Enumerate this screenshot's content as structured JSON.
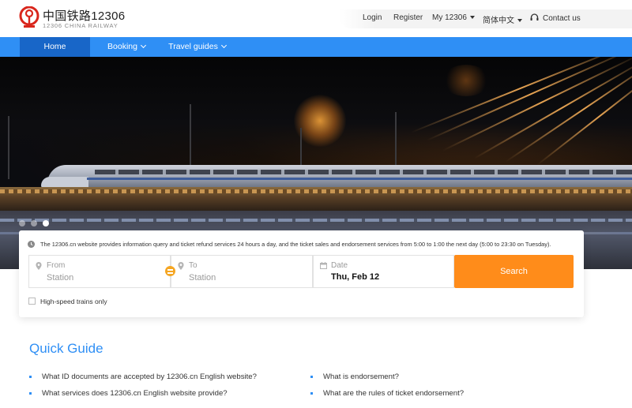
{
  "header": {
    "logo_cn": "中国铁路12306",
    "logo_en": "12306 CHINA RAILWAY",
    "links": {
      "login": "Login",
      "register": "Register",
      "my12306": "My 12306",
      "language": "简体中文",
      "contact": "Contact us"
    }
  },
  "nav": {
    "home": "Home",
    "booking": "Booking",
    "travel_guides": "Travel guides"
  },
  "hero": {
    "slides_count": 3,
    "active_slide": 3
  },
  "search": {
    "notice": "The 12306.cn website provides information query and ticket refund services 24 hours a day, and the ticket sales and endorsement services from 5:00 to 1:00 the next day (5:00 to 23:30 on Tuesday).",
    "from_label": "From",
    "from_placeholder": "Station",
    "to_label": "To",
    "to_placeholder": "Station",
    "date_label": "Date",
    "date_value": "Thu, Feb 12",
    "button": "Search",
    "high_speed_label": "High-speed trains only"
  },
  "quick_guide": {
    "title": "Quick Guide",
    "left": [
      "What ID documents are accepted by 12306.cn English website?",
      "What services does 12306.cn English website provide?"
    ],
    "right": [
      "What is endorsement?",
      "What are the rules of ticket endorsement?"
    ]
  },
  "colors": {
    "brand_blue": "#2f8ff5",
    "nav_active": "#1866c8",
    "search_orange": "#ff8c1a",
    "logo_red": "#d9261c"
  }
}
